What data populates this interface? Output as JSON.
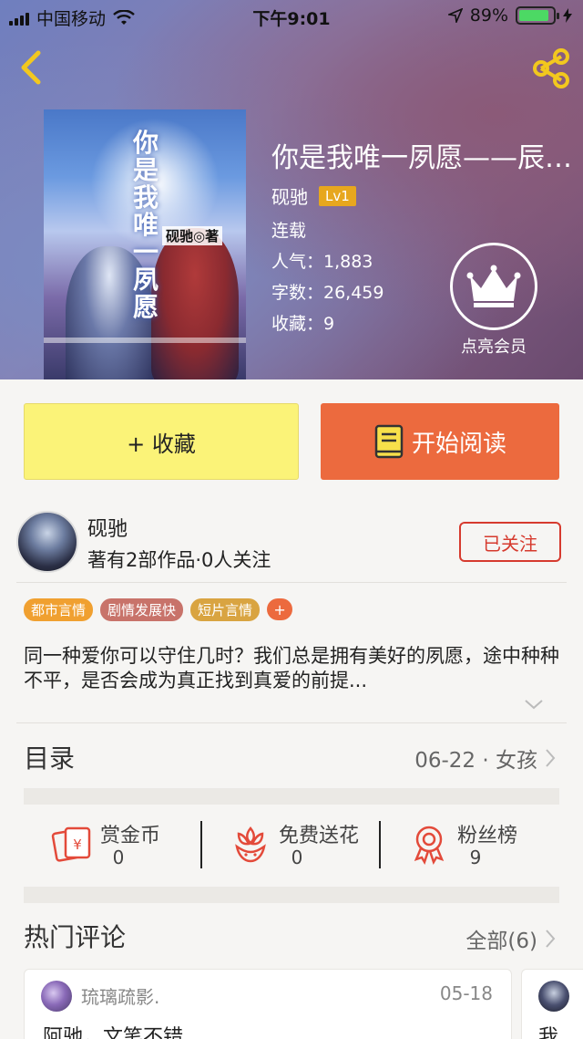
{
  "status_bar": {
    "carrier": "中国移动",
    "time": "下午9:01",
    "battery_text": "89%",
    "battery_level": 0.89
  },
  "book": {
    "title": "你是我唯一夙愿——辰…",
    "author": "砚驰",
    "level": "Lv1",
    "status": "连载",
    "popularity": "人气：1,883",
    "word_count": "字数：26,459",
    "favorites": "收藏：9",
    "cover_title": "你是我唯一夙愿",
    "cover_author": "砚驰◎著"
  },
  "vip": {
    "label": "点亮会员"
  },
  "actions": {
    "collect_label": "+ 收藏",
    "read_label": "开始阅读"
  },
  "author_info": {
    "name": "砚驰",
    "meta": "著有2部作品·0人关注",
    "follow_label": "已关注"
  },
  "tags": [
    {
      "label": "都市言情",
      "color": "#f0a030"
    },
    {
      "label": "剧情发展快",
      "color": "#c8736a"
    },
    {
      "label": "短片言情",
      "color": "#d9a441"
    }
  ],
  "tag_more": "+",
  "synopsis": "同一种爱你可以守住几时？我们总是拥有美好的夙愿，途中种种不平，是否会成为真正找到真爱的前提...",
  "toc": {
    "label": "目录",
    "latest": "06-22 · 女孩"
  },
  "stats": [
    {
      "label": "赏金币",
      "count": "0",
      "icon": "gold-coin-icon"
    },
    {
      "label": "免费送花",
      "count": "0",
      "icon": "flower-icon"
    },
    {
      "label": "粉丝榜",
      "count": "9",
      "icon": "medal-icon"
    }
  ],
  "comments_section": {
    "label": "热门评论",
    "all_label": "全部(6)"
  },
  "comments": [
    {
      "user": "琉璃疏影.",
      "date": "05-18",
      "text": "阿驰，文笔不错"
    },
    {
      "text": "我"
    }
  ],
  "colors": {
    "accent_orange": "#ec6a3e",
    "collect_yellow": "#fbf378",
    "follow_red": "#d63a2e",
    "level_gold": "#e7a71e",
    "icon_yellow": "#f2c81e"
  }
}
